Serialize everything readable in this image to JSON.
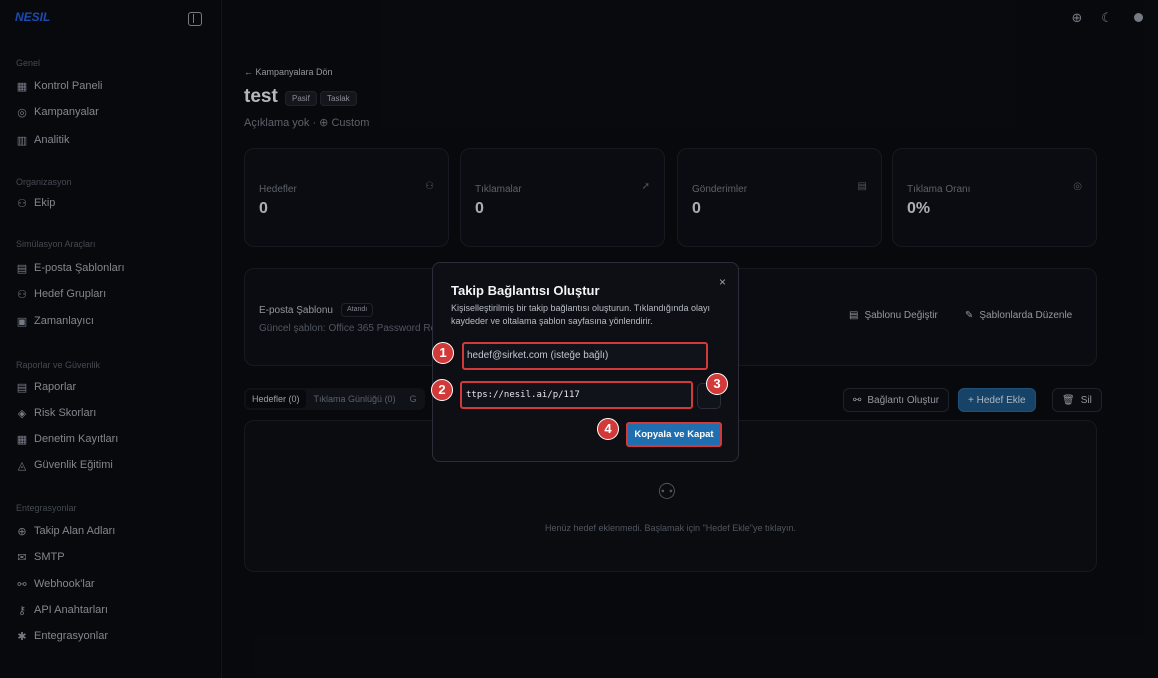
{
  "app": {
    "logo": "NESIL"
  },
  "sidebar": {
    "groups": [
      {
        "label": "Genel",
        "items": [
          {
            "label": "Kontrol Paneli",
            "icon": "grid-icon"
          },
          {
            "label": "Kampanyalar",
            "icon": "target-icon"
          },
          {
            "label": "Analitik",
            "icon": "bar-chart-icon"
          }
        ]
      },
      {
        "label": "Organizasyon",
        "items": [
          {
            "label": "Ekip",
            "icon": "users-icon"
          }
        ]
      },
      {
        "label": "Simülasyon Araçları",
        "items": [
          {
            "label": "E-posta Şablonları",
            "icon": "file-icon"
          },
          {
            "label": "Hedef Grupları",
            "icon": "user-group-icon"
          },
          {
            "label": "Zamanlayıcı",
            "icon": "calendar-icon"
          }
        ]
      },
      {
        "label": "Raporlar ve Güvenlik",
        "items": [
          {
            "label": "Raporlar",
            "icon": "report-icon"
          },
          {
            "label": "Risk Skorları",
            "icon": "shield-icon"
          },
          {
            "label": "Denetim Kayıtları",
            "icon": "log-icon"
          },
          {
            "label": "Güvenlik Eğitimi",
            "icon": "graduation-icon"
          }
        ]
      },
      {
        "label": "Entegrasyonlar",
        "items": [
          {
            "label": "Takip Alan Adları",
            "icon": "globe-icon"
          },
          {
            "label": "SMTP",
            "icon": "mail-icon"
          },
          {
            "label": "Webhook'lar",
            "icon": "webhook-icon"
          },
          {
            "label": "API Anahtarları",
            "icon": "key-icon"
          },
          {
            "label": "Entegrasyonlar",
            "icon": "puzzle-icon"
          }
        ]
      }
    ]
  },
  "campaign": {
    "back_label": "← Kampanyalara Dön",
    "title": "test",
    "badges": [
      "Pasif",
      "Taslak"
    ],
    "subtitle": "Açıklama yok · ⊕ Custom"
  },
  "stats": [
    {
      "label": "Hedefler",
      "value": "0",
      "icon": "users-icon"
    },
    {
      "label": "Tıklamalar",
      "value": "0",
      "icon": "pointer-icon"
    },
    {
      "label": "Gönderimler",
      "value": "0",
      "icon": "file-icon"
    },
    {
      "label": "Tıklama Oranı",
      "value": "0%",
      "icon": "target-icon"
    }
  ],
  "template": {
    "label": "E-posta Şablonu",
    "badge": "Atandı",
    "current": "Güncel şablon: Office 365 Password Re",
    "change_btn": "Şablonu Değiştir",
    "edit_btn": "Şablonlarda Düzenle"
  },
  "tabs": [
    {
      "label": "Hedefler (0)",
      "active": true
    },
    {
      "label": "Tıklama Günlüğü (0)",
      "active": false
    },
    {
      "label": "G",
      "active": false
    }
  ],
  "actions": {
    "create_link": "Bağlantı Oluştur",
    "add_target": "+ Hedef Ekle",
    "delete": "Sil"
  },
  "empty_state": {
    "text": "Henüz hedef eklenmedi. Başlamak için \"Hedef Ekle\"ye tıklayın."
  },
  "modal": {
    "title": "Takip Bağlantısı Oluştur",
    "description": "Kişiselleştirilmiş bir takip bağlantısı oluşturun. Tıklandığında olayı kaydeder ve oltalama şablon sayfasına yönlendirir.",
    "email_placeholder": "hedef@sirket.com (isteğe bağlı)",
    "email_display": "hedef@sirket.com (isteğe bağlı)",
    "link_value": "ttps://nesil.ai/p/117",
    "copy_close": "Kopyala ve Kapat",
    "close": "×"
  },
  "steps": [
    "1",
    "2",
    "3",
    "4"
  ],
  "colors": {
    "accent": "#1f6fb0",
    "highlight": "#d23a3a",
    "bg": "#0b0d12"
  }
}
